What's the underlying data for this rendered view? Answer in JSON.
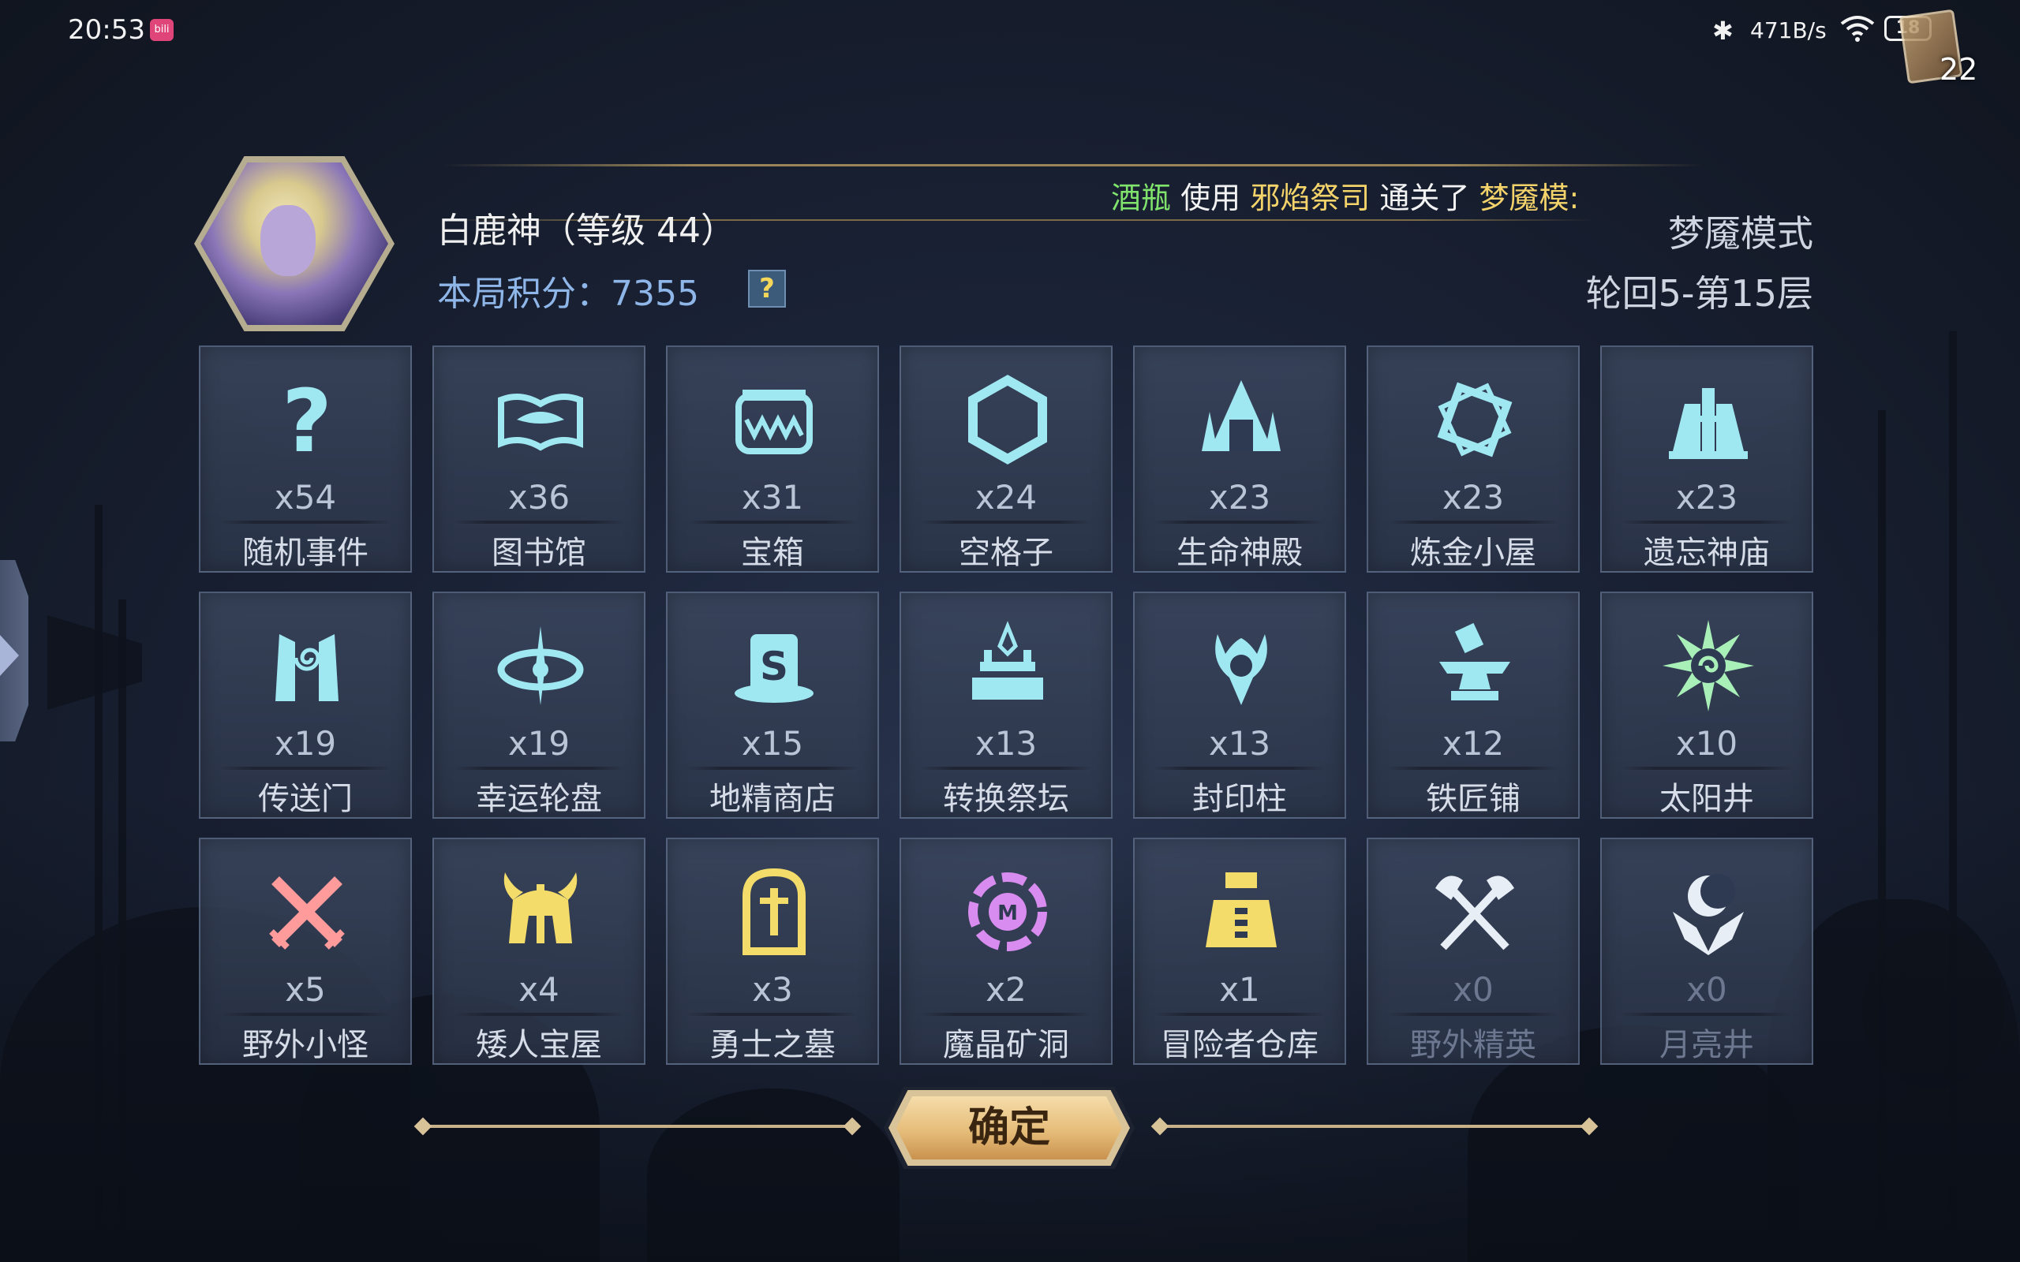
{
  "status_bar": {
    "time": "20:53",
    "app_icon_text": "bili",
    "net_speed": "471B/s",
    "battery": "18",
    "corner_count": "22"
  },
  "header": {
    "player_name": "白鹿神（等级 44）",
    "score_label": "本局积分：7355",
    "help_symbol": "?",
    "ticker": {
      "player": "酒瓶",
      "word_use": "使用",
      "hero": "邪焰祭司",
      "word_clear": "通关了",
      "mode": "梦魇模:"
    },
    "mode": "梦魇模式",
    "level": "轮回5-第15层"
  },
  "tiles": [
    {
      "count": "x54",
      "name": "随机事件",
      "icon": "question-icon",
      "color": "#9fe8f2"
    },
    {
      "count": "x36",
      "name": "图书馆",
      "icon": "book-icon",
      "color": "#9fe8f2"
    },
    {
      "count": "x31",
      "name": "宝箱",
      "icon": "mimic-chest-icon",
      "color": "#9fe8f2"
    },
    {
      "count": "x24",
      "name": "空格子",
      "icon": "hexagon-icon",
      "color": "#9fe8f2"
    },
    {
      "count": "x23",
      "name": "生命神殿",
      "icon": "temple-icon",
      "color": "#9fe8f2"
    },
    {
      "count": "x23",
      "name": "炼金小屋",
      "icon": "alchemy-icon",
      "color": "#9fe8f2"
    },
    {
      "count": "x23",
      "name": "遗忘神庙",
      "icon": "shrine-icon",
      "color": "#9fe8f2"
    },
    {
      "count": "x19",
      "name": "传送门",
      "icon": "portal-icon",
      "color": "#9fe8f2"
    },
    {
      "count": "x19",
      "name": "幸运轮盘",
      "icon": "wheel-icon",
      "color": "#9fe8f2"
    },
    {
      "count": "x15",
      "name": "地精商店",
      "icon": "goblin-shop-icon",
      "color": "#9fe8f2"
    },
    {
      "count": "x13",
      "name": "转换祭坛",
      "icon": "altar-icon",
      "color": "#9fe8f2"
    },
    {
      "count": "x13",
      "name": "封印柱",
      "icon": "seal-pillar-icon",
      "color": "#9fe8f2"
    },
    {
      "count": "x12",
      "name": "铁匠铺",
      "icon": "anvil-icon",
      "color": "#9fe8f2"
    },
    {
      "count": "x10",
      "name": "太阳井",
      "icon": "sun-well-icon",
      "color": "#a9f0b8"
    },
    {
      "count": "x5",
      "name": "野外小怪",
      "icon": "crossed-swords-icon",
      "color": "#ff9b9b"
    },
    {
      "count": "x4",
      "name": "矮人宝屋",
      "icon": "dwarf-helmet-icon",
      "color": "#f4dc6a"
    },
    {
      "count": "x3",
      "name": "勇士之墓",
      "icon": "tomb-icon",
      "color": "#f4dc6a"
    },
    {
      "count": "x2",
      "name": "魔晶矿洞",
      "icon": "crystal-mine-icon",
      "color": "#d98cf0"
    },
    {
      "count": "x1",
      "name": "冒险者仓库",
      "icon": "warehouse-icon",
      "color": "#f4dc6a"
    },
    {
      "count": "x0",
      "name": "野外精英",
      "icon": "crossed-axes-icon",
      "color": "#e8eef5"
    },
    {
      "count": "x0",
      "name": "月亮井",
      "icon": "moon-well-icon",
      "color": "#e8eef5"
    }
  ],
  "confirm_label": "确定"
}
